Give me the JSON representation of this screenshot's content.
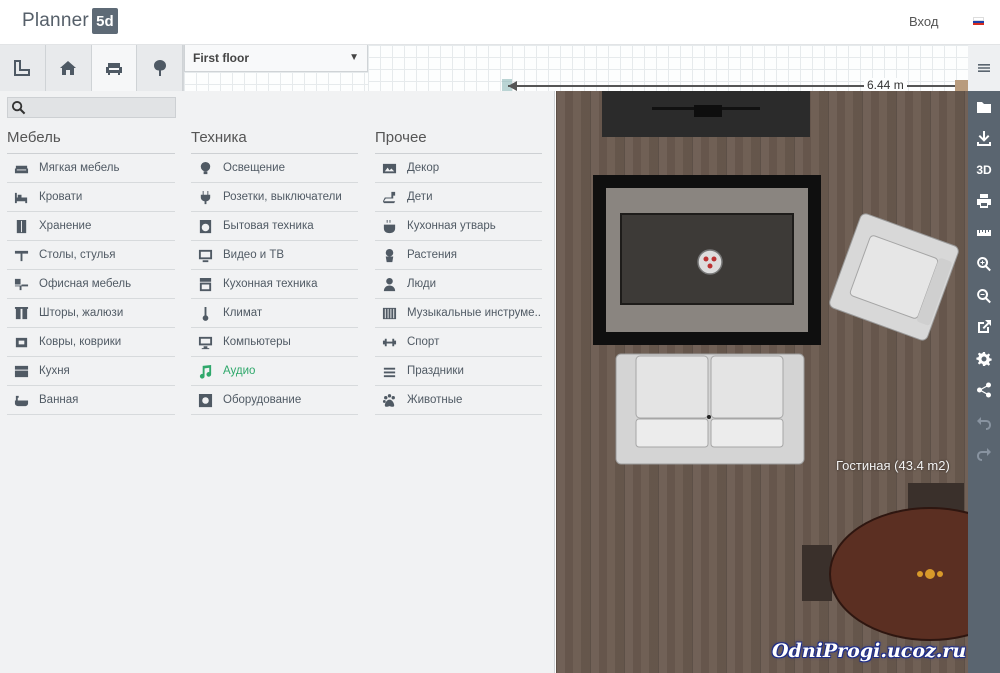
{
  "app": {
    "logo_text": "Planner",
    "logo_badge": "5d"
  },
  "header": {
    "login_label": "Вход",
    "language_icon": "flag-ru-icon"
  },
  "toolbar": {
    "tools": [
      {
        "name": "rooms",
        "icon": "room-shape-icon",
        "active": true
      },
      {
        "name": "construction",
        "icon": "house-icon",
        "active": false
      },
      {
        "name": "furniture",
        "icon": "sofa-icon",
        "active": true
      },
      {
        "name": "exterior",
        "icon": "tree-icon",
        "active": false
      }
    ],
    "floor": {
      "selected": "First floor"
    }
  },
  "dimension": {
    "label": "6.44 m"
  },
  "search": {
    "placeholder": "",
    "value": ""
  },
  "columns": [
    {
      "title": "Мебель",
      "items": [
        {
          "label": "Мягкая мебель",
          "icon": "sofa-icon"
        },
        {
          "label": "Кровати",
          "icon": "bed-icon"
        },
        {
          "label": "Хранение",
          "icon": "wardrobe-icon"
        },
        {
          "label": "Столы, стулья",
          "icon": "table-icon"
        },
        {
          "label": "Офисная мебель",
          "icon": "office-desk-icon"
        },
        {
          "label": "Шторы, жалюзи",
          "icon": "curtains-icon"
        },
        {
          "label": "Ковры, коврики",
          "icon": "rug-icon"
        },
        {
          "label": "Кухня",
          "icon": "kitchen-icon"
        },
        {
          "label": "Ванная",
          "icon": "bathtub-icon"
        }
      ]
    },
    {
      "title": "Техника",
      "items": [
        {
          "label": "Освещение",
          "icon": "bulb-icon"
        },
        {
          "label": "Розетки, выключатели",
          "icon": "plug-icon"
        },
        {
          "label": "Бытовая техника",
          "icon": "washing-machine-icon"
        },
        {
          "label": "Видео и ТВ",
          "icon": "tv-icon"
        },
        {
          "label": "Кухонная техника",
          "icon": "stove-icon"
        },
        {
          "label": "Климат",
          "icon": "thermometer-icon"
        },
        {
          "label": "Компьютеры",
          "icon": "monitor-icon"
        },
        {
          "label": "Аудио",
          "icon": "music-note-icon",
          "active": true
        },
        {
          "label": "Оборудование",
          "icon": "gear-icon"
        }
      ]
    },
    {
      "title": "Прочее",
      "items": [
        {
          "label": "Декор",
          "icon": "picture-icon"
        },
        {
          "label": "Дети",
          "icon": "rocking-horse-icon"
        },
        {
          "label": "Кухонная утварь",
          "icon": "pot-icon"
        },
        {
          "label": "Растения",
          "icon": "plant-icon"
        },
        {
          "label": "Люди",
          "icon": "person-icon"
        },
        {
          "label": "Музыкальные инструме...",
          "icon": "piano-icon"
        },
        {
          "label": "Спорт",
          "icon": "dumbbell-icon"
        },
        {
          "label": "Праздники",
          "icon": "cake-icon"
        },
        {
          "label": "Животные",
          "icon": "paw-icon"
        }
      ]
    }
  ],
  "plan": {
    "room_label": "Гостиная (43.4 m2)"
  },
  "rail": {
    "three_d_label": "3D",
    "buttons": [
      "menu-icon",
      "folder-icon",
      "download-icon",
      "3d-icon",
      "print-icon",
      "ruler-icon",
      "zoom-in-icon",
      "zoom-out-icon",
      "external-link-icon",
      "settings-icon",
      "share-icon",
      "undo-icon",
      "redo-icon"
    ]
  },
  "watermark": {
    "text": "OdniProgi.ucoz.ru"
  },
  "colors": {
    "accent": "#2fa86b",
    "rail": "#5a6570",
    "floor_wood": "#6b5b50"
  }
}
